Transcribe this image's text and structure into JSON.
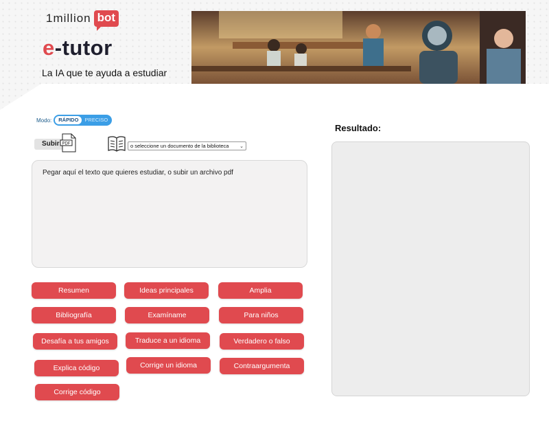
{
  "header": {
    "logo_text": "1million",
    "logo_badge": "bot",
    "brand_prefix": "e",
    "brand_suffix": "-tutor",
    "tagline": "La IA que te ayuda a estudiar"
  },
  "mode": {
    "label": "Modo:",
    "options": [
      "RÁPIDO",
      "PRECISO"
    ],
    "selected": "RÁPIDO"
  },
  "upload": {
    "button_label": "Subir",
    "file_icon_label": "PDF"
  },
  "library": {
    "selected_option": "o seleccione un documento de la biblioteca"
  },
  "input": {
    "placeholder": "Pegar aquí el texto que quieres estudiar, o subir un archivo pdf"
  },
  "actions": [
    "Resumen",
    "Ideas principales",
    "Amplia",
    "Bibliografía",
    "Examíname",
    "Para niños",
    "Desafía a tus amigos",
    "Traduce a un idioma",
    "Verdadero o falso",
    "Explica código",
    "Corrige un idioma",
    "Contraargumenta",
    "Corrige código"
  ],
  "result": {
    "label": "Resultado:"
  },
  "colors": {
    "accent": "#e04a4f",
    "toggle": "#3b9ee6"
  },
  "icons": {
    "pdf": "pdf-file-icon",
    "library": "book-icon",
    "dropdown": "chevron-down-icon"
  }
}
